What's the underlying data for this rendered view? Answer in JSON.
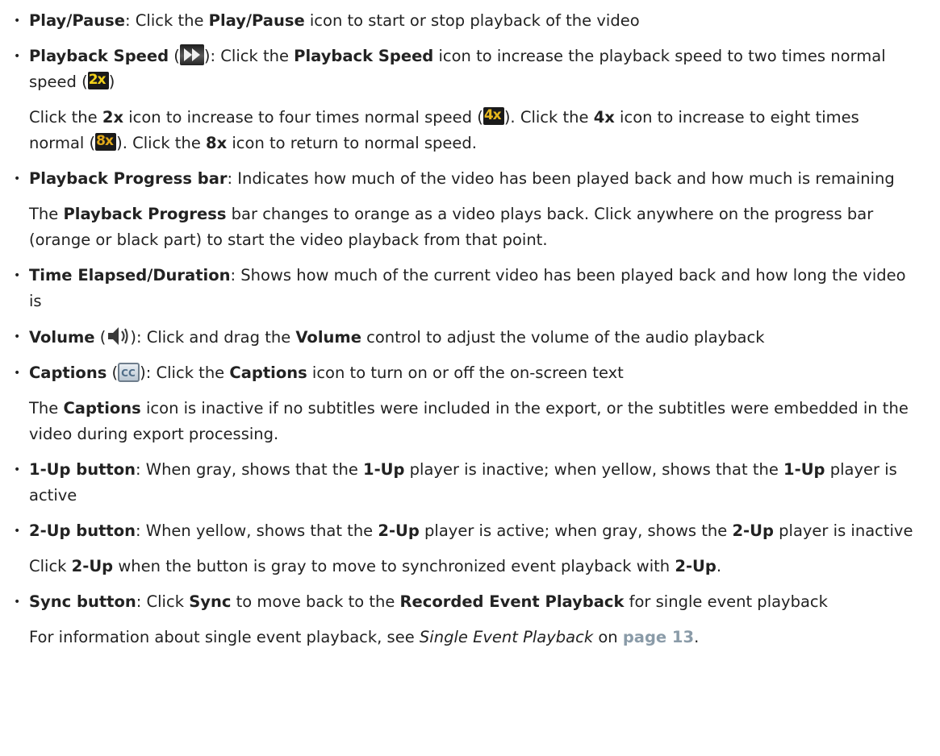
{
  "items": [
    {
      "parts": [
        {
          "b": "Play/Pause"
        },
        {
          "t": ": Click the "
        },
        {
          "b": "Play/Pause"
        },
        {
          "t": " icon to start or stop playback of the video"
        }
      ]
    },
    {
      "parts": [
        {
          "b": "Playback Speed"
        },
        {
          "t": " ("
        },
        {
          "icon": "fast-forward-icon"
        },
        {
          "t": "): Click the "
        },
        {
          "b": "Playback Speed"
        },
        {
          "t": " icon to increase the playback speed to two times normal speed ("
        },
        {
          "icon": "speed-2x-icon",
          "label": "2x"
        },
        {
          "t": ")"
        }
      ],
      "sub": [
        [
          {
            "t": "Click the "
          },
          {
            "b": "2x"
          },
          {
            "t": " icon to increase to four times normal speed ("
          },
          {
            "icon": "speed-4x-icon",
            "label": "4x"
          },
          {
            "t": "). Click the "
          },
          {
            "b": "4x"
          },
          {
            "t": " icon to increase to eight times normal ("
          },
          {
            "icon": "speed-8x-icon",
            "label": "8x"
          },
          {
            "t": "). Click the "
          },
          {
            "b": "8x"
          },
          {
            "t": " icon to return to normal speed."
          }
        ]
      ]
    },
    {
      "parts": [
        {
          "b": "Playback Progress bar"
        },
        {
          "t": ": Indicates how much of the video has been played back and how much is remaining"
        }
      ],
      "sub": [
        [
          {
            "t": "The "
          },
          {
            "b": "Playback Progress"
          },
          {
            "t": " bar changes to orange as a video plays back. Click anywhere on the progress bar (orange or black part) to start the video playback from that point."
          }
        ]
      ]
    },
    {
      "parts": [
        {
          "b": "Time Elapsed/Duration"
        },
        {
          "t": ": Shows how much of the current video has been played back and how long the video is"
        }
      ]
    },
    {
      "parts": [
        {
          "b": "Volume"
        },
        {
          "t": " ("
        },
        {
          "icon": "speaker-icon"
        },
        {
          "t": "): Click and drag the "
        },
        {
          "b": "Volume"
        },
        {
          "t": " control to adjust the volume of the audio playback"
        }
      ]
    },
    {
      "parts": [
        {
          "b": "Captions"
        },
        {
          "t": " ("
        },
        {
          "icon": "closed-captions-icon",
          "label": "CC"
        },
        {
          "t": "): Click the "
        },
        {
          "b": "Captions"
        },
        {
          "t": " icon to turn on or off the on-screen text"
        }
      ],
      "sub": [
        [
          {
            "t": "The "
          },
          {
            "b": "Captions"
          },
          {
            "t": " icon is inactive if no subtitles were included in the export, or the subtitles were embedded in the video during export processing."
          }
        ]
      ]
    },
    {
      "parts": [
        {
          "b": "1-Up button"
        },
        {
          "t": ": When gray, shows that the "
        },
        {
          "b": "1-Up"
        },
        {
          "t": " player is inactive; when yellow, shows that the "
        },
        {
          "b": "1-Up"
        },
        {
          "t": " player is active"
        }
      ]
    },
    {
      "parts": [
        {
          "b": "2-Up button"
        },
        {
          "t": ": When yellow, shows that the "
        },
        {
          "b": "2-Up"
        },
        {
          "t": " player is active; when gray, shows the "
        },
        {
          "b": "2-Up"
        },
        {
          "t": " player is inactive"
        }
      ],
      "sub": [
        [
          {
            "t": "Click "
          },
          {
            "b": "2-Up"
          },
          {
            "t": " when the button is gray to move to synchronized event playback with "
          },
          {
            "b": "2-Up"
          },
          {
            "t": "."
          }
        ]
      ]
    },
    {
      "parts": [
        {
          "b": "Sync button"
        },
        {
          "t": ": Click "
        },
        {
          "b": "Sync"
        },
        {
          "t": " to move back to the "
        },
        {
          "b": "Recorded Event Playback"
        },
        {
          "t": " for single event playback"
        }
      ],
      "sub": [
        [
          {
            "t": "For information about single event playback, see "
          },
          {
            "i": "Single Event Playback"
          },
          {
            "t": " on "
          },
          {
            "link": "page 13"
          },
          {
            "t": "."
          }
        ]
      ]
    }
  ],
  "bullet_char": "•",
  "colors": {
    "text": "#222222",
    "link": "#8a9ba8",
    "speed_yellow": "#e8b81c"
  }
}
